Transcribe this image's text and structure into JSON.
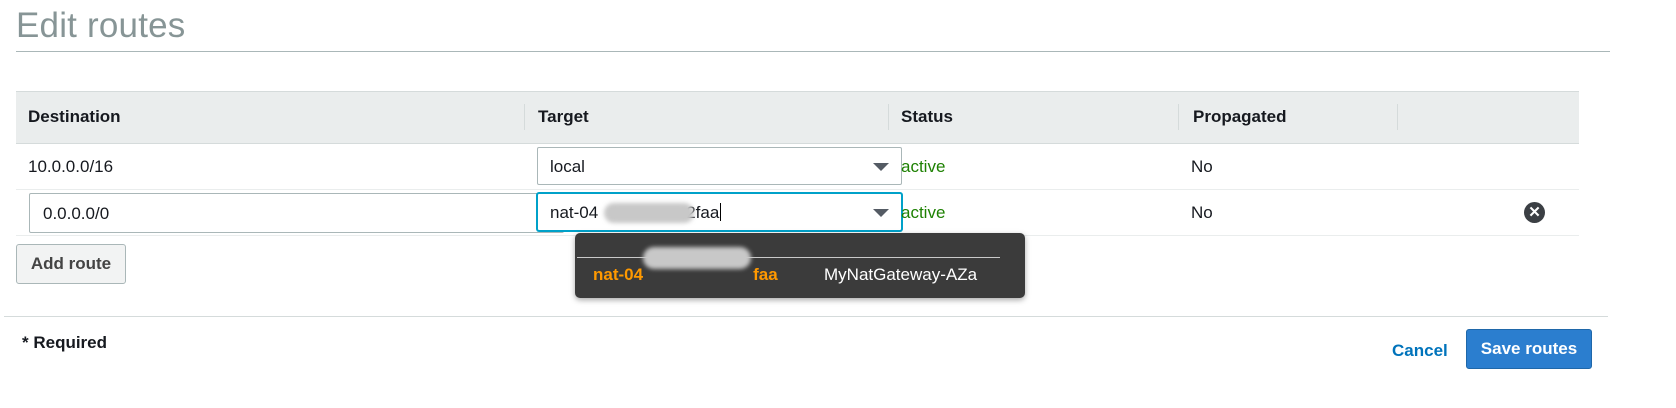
{
  "page": {
    "title": "Edit routes"
  },
  "table": {
    "headers": [
      "Destination",
      "Target",
      "Status",
      "Propagated"
    ],
    "rows": [
      {
        "destination": "10.0.0.0/16",
        "target": "local",
        "status": "active",
        "propagated": "No"
      },
      {
        "destination": "0.0.0.0/0",
        "target_prefix": "nat-04",
        "target_suffix": "2faa",
        "status": "active",
        "propagated": "No"
      }
    ]
  },
  "buttons": {
    "add_route": "Add route",
    "cancel": "Cancel",
    "save_routes": "Save routes"
  },
  "dropdown": {
    "option_id_prefix": "nat-04",
    "option_id_suffix": "faa",
    "option_name": "MyNatGateway-AZa"
  },
  "footer": {
    "required": "* Required"
  },
  "colors": {
    "accent": "#2b7ecf",
    "status_active": "#1d8102",
    "option_highlight": "#ff9900",
    "link": "#0073bb"
  },
  "icons": {
    "remove": "close-circle-icon",
    "select_caret": "chevron-down-icon"
  }
}
